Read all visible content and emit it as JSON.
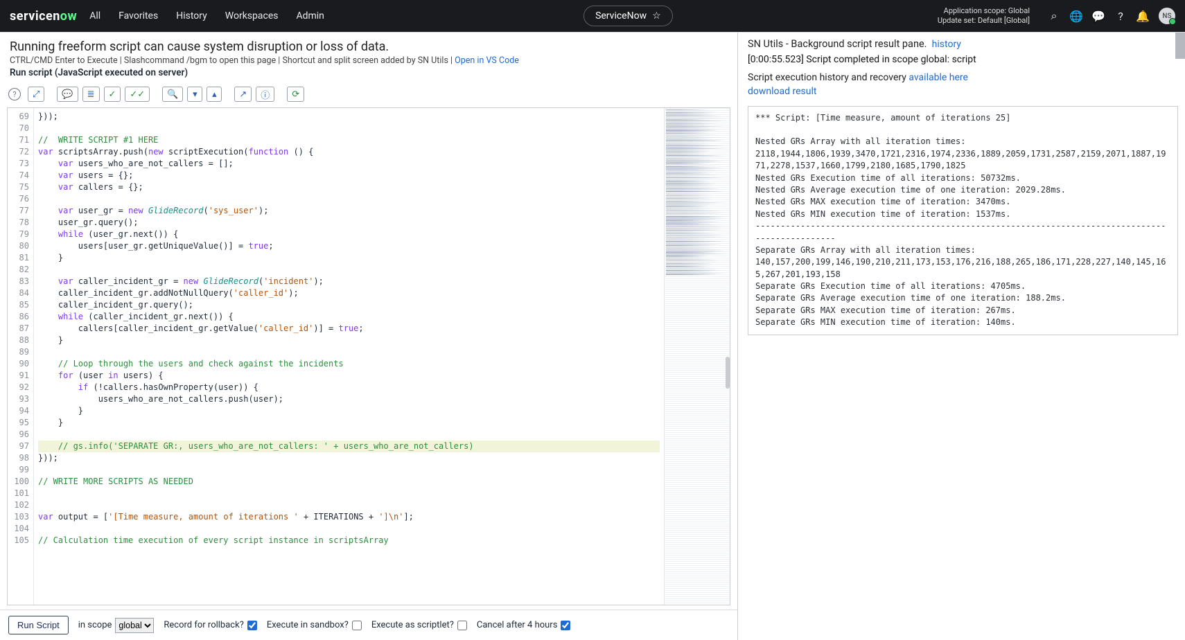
{
  "topnav": {
    "logo_left": "servicen",
    "logo_right": "ow",
    "links": [
      "All",
      "Favorites",
      "History",
      "Workspaces",
      "Admin"
    ],
    "pill_label": "ServiceNow",
    "scope_line1": "Application scope: Global",
    "scope_line2": "Update set: Default [Global]",
    "avatar": "NS"
  },
  "left": {
    "warning": "Running freeform script can cause system disruption or loss of data.",
    "subinfo_a": "CTRL/CMD Enter to Execute",
    "subinfo_b": "Slashcommand /bgm to open this page",
    "subinfo_c": "Shortcut and split screen added by SN Utils",
    "subinfo_link": "Open in VS Code",
    "runtitle": "Run script (JavaScript executed on server)"
  },
  "editor": {
    "first_line_no": 69,
    "lines": [
      {
        "t": "plain",
        "txt": "}));"
      },
      {
        "t": "blank"
      },
      {
        "t": "comment",
        "txt": "//  WRITE SCRIPT #1 HERE"
      },
      {
        "t": "code",
        "segs": [
          [
            "var",
            "scriptsArray"
          ],
          [
            "plain",
            ".push("
          ],
          [
            "kw",
            "new"
          ],
          [
            "plain",
            " scriptExecution("
          ],
          [
            "kw",
            "function"
          ],
          [
            "plain",
            " () {"
          ]
        ]
      },
      {
        "t": "code",
        "segs": [
          [
            "pad",
            "    "
          ],
          [
            "kw",
            "var"
          ],
          [
            "plain",
            " users_who_are_not_callers = [];"
          ]
        ]
      },
      {
        "t": "code",
        "segs": [
          [
            "pad",
            "    "
          ],
          [
            "kw",
            "var"
          ],
          [
            "plain",
            " users = {};"
          ]
        ]
      },
      {
        "t": "code",
        "segs": [
          [
            "pad",
            "    "
          ],
          [
            "kw",
            "var"
          ],
          [
            "plain",
            " callers = {};"
          ]
        ]
      },
      {
        "t": "blank"
      },
      {
        "t": "code",
        "segs": [
          [
            "pad",
            "    "
          ],
          [
            "kw",
            "var"
          ],
          [
            "plain",
            " user_gr = "
          ],
          [
            "kw",
            "new"
          ],
          [
            "plain",
            " "
          ],
          [
            "type",
            "GlideRecord"
          ],
          [
            "plain",
            "("
          ],
          [
            "str",
            "'sys_user'"
          ],
          [
            "plain",
            ");"
          ]
        ]
      },
      {
        "t": "code",
        "segs": [
          [
            "pad",
            "    "
          ],
          [
            "plain",
            "user_gr.query();"
          ]
        ]
      },
      {
        "t": "code",
        "segs": [
          [
            "pad",
            "    "
          ],
          [
            "kw",
            "while"
          ],
          [
            "plain",
            " (user_gr.next()) {"
          ]
        ]
      },
      {
        "t": "code",
        "segs": [
          [
            "pad",
            "        "
          ],
          [
            "plain",
            "users[user_gr.getUniqueValue()] = "
          ],
          [
            "bool",
            "true"
          ],
          [
            "plain",
            ";"
          ]
        ]
      },
      {
        "t": "code",
        "segs": [
          [
            "pad",
            "    "
          ],
          [
            "plain",
            "}"
          ]
        ]
      },
      {
        "t": "blank"
      },
      {
        "t": "code",
        "segs": [
          [
            "pad",
            "    "
          ],
          [
            "kw",
            "var"
          ],
          [
            "plain",
            " caller_incident_gr = "
          ],
          [
            "kw",
            "new"
          ],
          [
            "plain",
            " "
          ],
          [
            "type",
            "GlideRecord"
          ],
          [
            "plain",
            "("
          ],
          [
            "str",
            "'incident'"
          ],
          [
            "plain",
            ");"
          ]
        ]
      },
      {
        "t": "code",
        "segs": [
          [
            "pad",
            "    "
          ],
          [
            "plain",
            "caller_incident_gr.addNotNullQuery("
          ],
          [
            "str",
            "'caller_id'"
          ],
          [
            "plain",
            ");"
          ]
        ]
      },
      {
        "t": "code",
        "segs": [
          [
            "pad",
            "    "
          ],
          [
            "plain",
            "caller_incident_gr.query();"
          ]
        ]
      },
      {
        "t": "code",
        "segs": [
          [
            "pad",
            "    "
          ],
          [
            "kw",
            "while"
          ],
          [
            "plain",
            " (caller_incident_gr.next()) {"
          ]
        ]
      },
      {
        "t": "code",
        "segs": [
          [
            "pad",
            "        "
          ],
          [
            "plain",
            "callers[caller_incident_gr.getValue("
          ],
          [
            "str",
            "'caller_id'"
          ],
          [
            "plain",
            ")] = "
          ],
          [
            "bool",
            "true"
          ],
          [
            "plain",
            ";"
          ]
        ]
      },
      {
        "t": "code",
        "segs": [
          [
            "pad",
            "    "
          ],
          [
            "plain",
            "}"
          ]
        ]
      },
      {
        "t": "blank"
      },
      {
        "t": "comment",
        "txt": "    // Loop through the users and check against the incidents"
      },
      {
        "t": "code",
        "segs": [
          [
            "pad",
            "    "
          ],
          [
            "kw",
            "for"
          ],
          [
            "plain",
            " (user "
          ],
          [
            "kw",
            "in"
          ],
          [
            "plain",
            " users) {"
          ]
        ]
      },
      {
        "t": "code",
        "segs": [
          [
            "pad",
            "        "
          ],
          [
            "kw",
            "if"
          ],
          [
            "plain",
            " (!callers.hasOwnProperty(user)) {"
          ]
        ]
      },
      {
        "t": "code",
        "segs": [
          [
            "pad",
            "            "
          ],
          [
            "plain",
            "users_who_are_not_callers.push(user);"
          ]
        ]
      },
      {
        "t": "code",
        "segs": [
          [
            "pad",
            "        "
          ],
          [
            "plain",
            "}"
          ]
        ]
      },
      {
        "t": "code",
        "segs": [
          [
            "pad",
            "    "
          ],
          [
            "plain",
            "}"
          ]
        ]
      },
      {
        "t": "blank"
      },
      {
        "t": "comment",
        "hl": true,
        "txt": "    // gs.info('SEPARATE GR:, users_who_are_not_callers: ' + users_who_are_not_callers)"
      },
      {
        "t": "plain",
        "txt": "}));"
      },
      {
        "t": "blank"
      },
      {
        "t": "comment",
        "txt": "// WRITE MORE SCRIPTS AS NEEDED"
      },
      {
        "t": "blank"
      },
      {
        "t": "blank"
      },
      {
        "t": "code",
        "segs": [
          [
            "kw",
            "var"
          ],
          [
            "plain",
            " output = ["
          ],
          [
            "str",
            "'[Time measure, amount of iterations '"
          ],
          [
            "plain",
            " + ITERATIONS + "
          ],
          [
            "str",
            "']\\n'"
          ],
          [
            "plain",
            "];"
          ]
        ]
      },
      {
        "t": "blank"
      },
      {
        "t": "comment",
        "txt": "// Calculation time execution of every script instance in scriptsArray"
      }
    ]
  },
  "footer": {
    "run_label": "Run Script",
    "scope_label": "in scope",
    "scope_value": "global",
    "rollback_label": "Record for rollback?",
    "sandbox_label": "Execute in sandbox?",
    "scriptlet_label": "Execute as scriptlet?",
    "cancel_label": "Cancel after 4 hours",
    "rollback": true,
    "sandbox": false,
    "scriptlet": false,
    "cancel": true
  },
  "right": {
    "title": "SN Utils - Background script result pane.",
    "history_link": "history",
    "status": "[0:00:55.523] Script completed in scope global: script",
    "recovery_text": "Script execution history and recovery ",
    "recovery_link": "available here",
    "download_link": "download result",
    "console": "*** Script: [Time measure, amount of iterations 25]\n\nNested GRs Array with all iteration times: 2118,1944,1806,1939,3470,1721,2316,1974,2336,1889,2059,1731,2587,2159,2071,1887,1971,2278,1537,1660,1799,2180,1685,1790,1825\nNested GRs Execution time of all iterations: 50732ms.\nNested GRs Average execution time of one iteration: 2029.28ms.\nNested GRs MAX execution time of iteration: 3470ms.\nNested GRs MIN execution time of iteration: 1537ms.\n--------------------------------------------------------------------------------------------------\nSeparate GRs Array with all iteration times: 140,157,200,199,146,190,210,211,173,153,176,216,188,265,186,171,228,227,140,145,165,267,201,193,158\nSeparate GRs Execution time of all iterations: 4705ms.\nSeparate GRs Average execution time of one iteration: 188.2ms.\nSeparate GRs MAX execution time of iteration: 267ms.\nSeparate GRs MIN execution time of iteration: 140ms."
  },
  "chart_data": {
    "type": "table",
    "title": "Background script iteration timings (25 iterations)",
    "series": [
      {
        "name": "Nested GRs",
        "unit": "ms",
        "values": [
          2118,
          1944,
          1806,
          1939,
          3470,
          1721,
          2316,
          1974,
          2336,
          1889,
          2059,
          1731,
          2587,
          2159,
          2071,
          1887,
          1971,
          2278,
          1537,
          1660,
          1799,
          2180,
          1685,
          1790,
          1825
        ],
        "total": 50732,
        "avg": 2029.28,
        "max": 3470,
        "min": 1537
      },
      {
        "name": "Separate GRs",
        "unit": "ms",
        "values": [
          140,
          157,
          200,
          199,
          146,
          190,
          210,
          211,
          173,
          153,
          176,
          216,
          188,
          265,
          186,
          171,
          228,
          227,
          140,
          145,
          165,
          267,
          201,
          193,
          158
        ],
        "total": 4705,
        "avg": 188.2,
        "max": 267,
        "min": 140
      }
    ]
  }
}
